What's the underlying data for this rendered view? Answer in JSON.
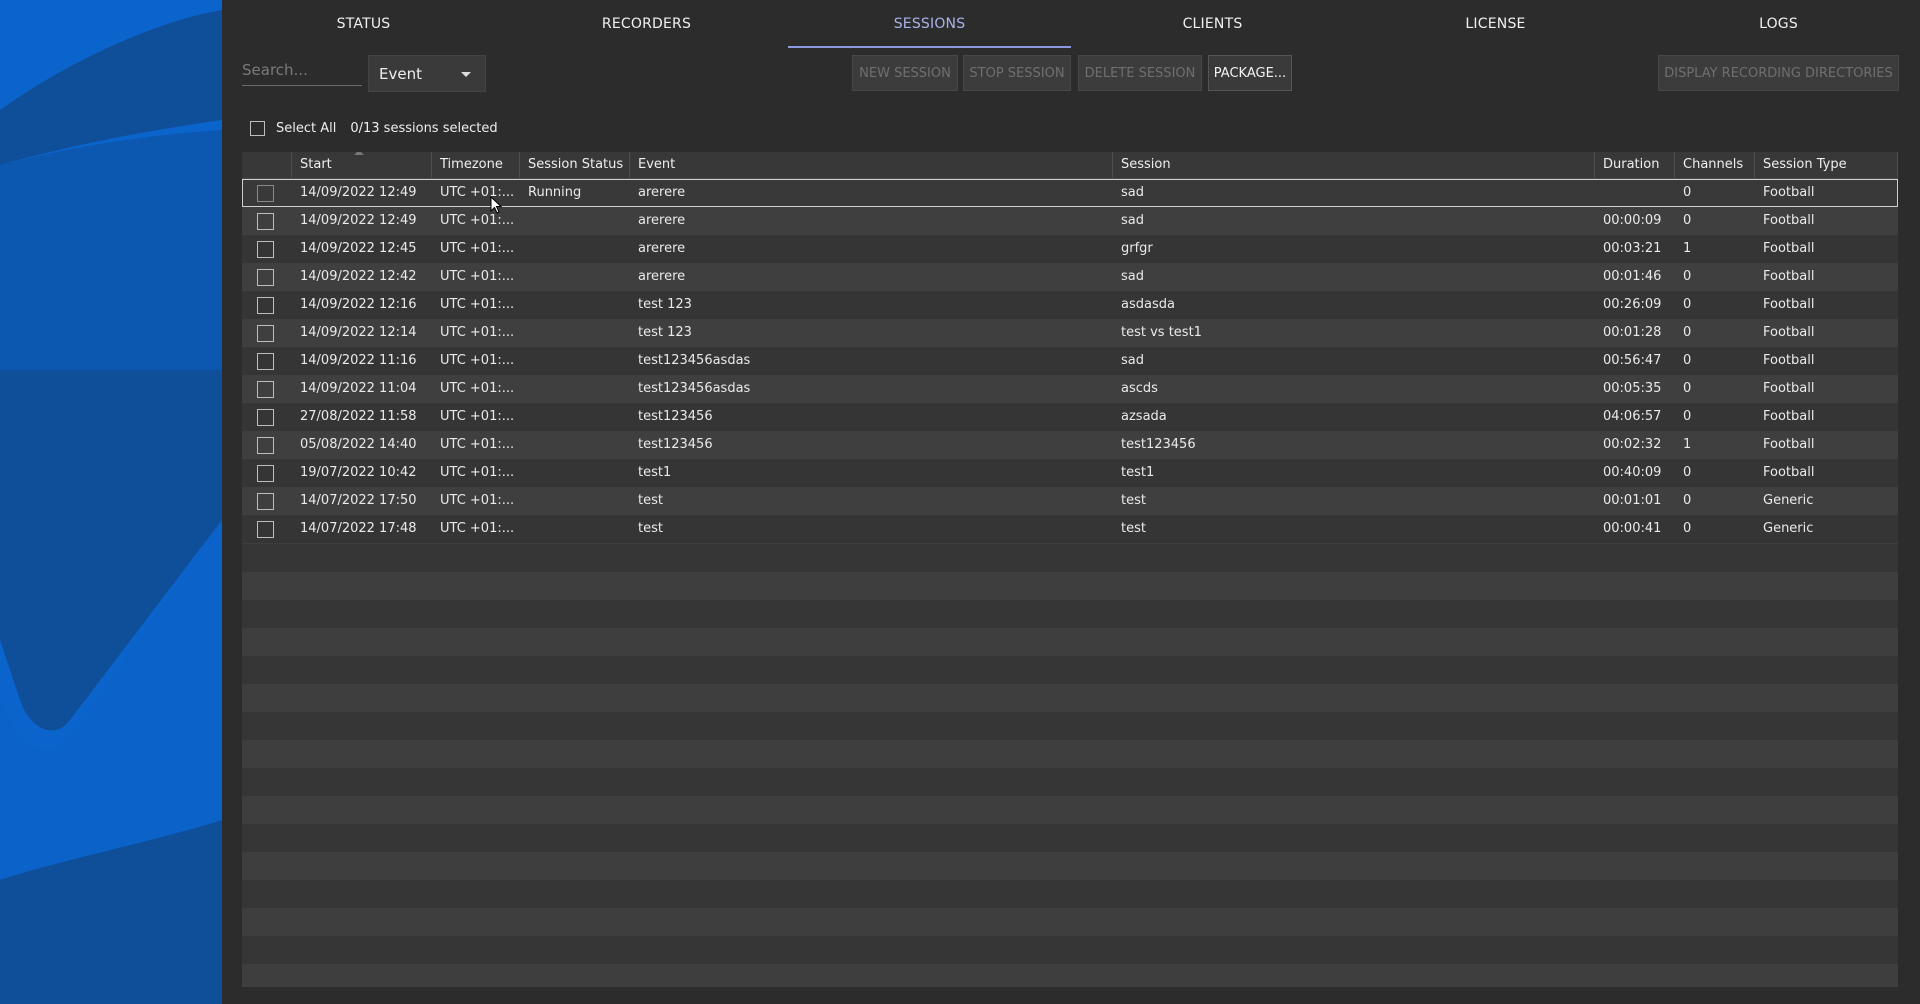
{
  "tabs": [
    {
      "label": "STATUS"
    },
    {
      "label": "RECORDERS"
    },
    {
      "label": "SESSIONS",
      "active": true
    },
    {
      "label": "CLIENTS"
    },
    {
      "label": "LICENSE"
    },
    {
      "label": "LOGS"
    }
  ],
  "toolbar": {
    "search_placeholder": "Search...",
    "filter_selected": "Event",
    "new_session": "NEW SESSION",
    "stop_session": "STOP SESSION",
    "delete_session": "DELETE SESSION",
    "package": "PACKAGE...",
    "display_dirs": "DISPLAY RECORDING DIRECTORIES"
  },
  "selection": {
    "select_all_label": "Select All",
    "count_text": "0/13 sessions selected"
  },
  "table": {
    "columns": [
      "",
      "Start",
      "Timezone",
      "Session Status",
      "Event",
      "Session",
      "Duration",
      "Channels",
      "Session Type"
    ],
    "rows": [
      [
        "14/09/2022 12:49",
        "UTC +01:...",
        "Running",
        "arerere",
        "sad",
        "",
        "0",
        "Football"
      ],
      [
        "14/09/2022 12:49",
        "UTC +01:...",
        "",
        "arerere",
        "sad",
        "00:00:09",
        "0",
        "Football"
      ],
      [
        "14/09/2022 12:45",
        "UTC +01:...",
        "",
        "arerere",
        "grfgr",
        "00:03:21",
        "1",
        "Football"
      ],
      [
        "14/09/2022 12:42",
        "UTC +01:...",
        "",
        "arerere",
        "sad",
        "00:01:46",
        "0",
        "Football"
      ],
      [
        "14/09/2022 12:16",
        "UTC +01:...",
        "",
        "test 123",
        "asdasda",
        "00:26:09",
        "0",
        "Football"
      ],
      [
        "14/09/2022 12:14",
        "UTC +01:...",
        "",
        "test 123",
        "test vs test1",
        "00:01:28",
        "0",
        "Football"
      ],
      [
        "14/09/2022 11:16",
        "UTC +01:...",
        "",
        "test123456asdas",
        "sad",
        "00:56:47",
        "0",
        "Football"
      ],
      [
        "14/09/2022 11:04",
        "UTC +01:...",
        "",
        "test123456asdas",
        "ascds",
        "00:05:35",
        "0",
        "Football"
      ],
      [
        "27/08/2022 11:58",
        "UTC +01:...",
        "",
        "test123456",
        "azsada",
        "04:06:57",
        "0",
        "Football"
      ],
      [
        "05/08/2022 14:40",
        "UTC +01:...",
        "",
        "test123456",
        "test123456",
        "00:02:32",
        "1",
        "Football"
      ],
      [
        "19/07/2022 10:42",
        "UTC +01:...",
        "",
        "test1",
        "test1",
        "00:40:09",
        "0",
        "Football"
      ],
      [
        "14/07/2022 17:50",
        "UTC +01:...",
        "",
        "test",
        "test",
        "00:01:01",
        "0",
        "Generic"
      ],
      [
        "14/07/2022 17:48",
        "UTC +01:...",
        "",
        "test",
        "test",
        "00:00:41",
        "0",
        "Generic"
      ]
    ]
  },
  "colors": {
    "sidebar_blue": "#0a62c9",
    "active_tab": "#aab4ea"
  }
}
